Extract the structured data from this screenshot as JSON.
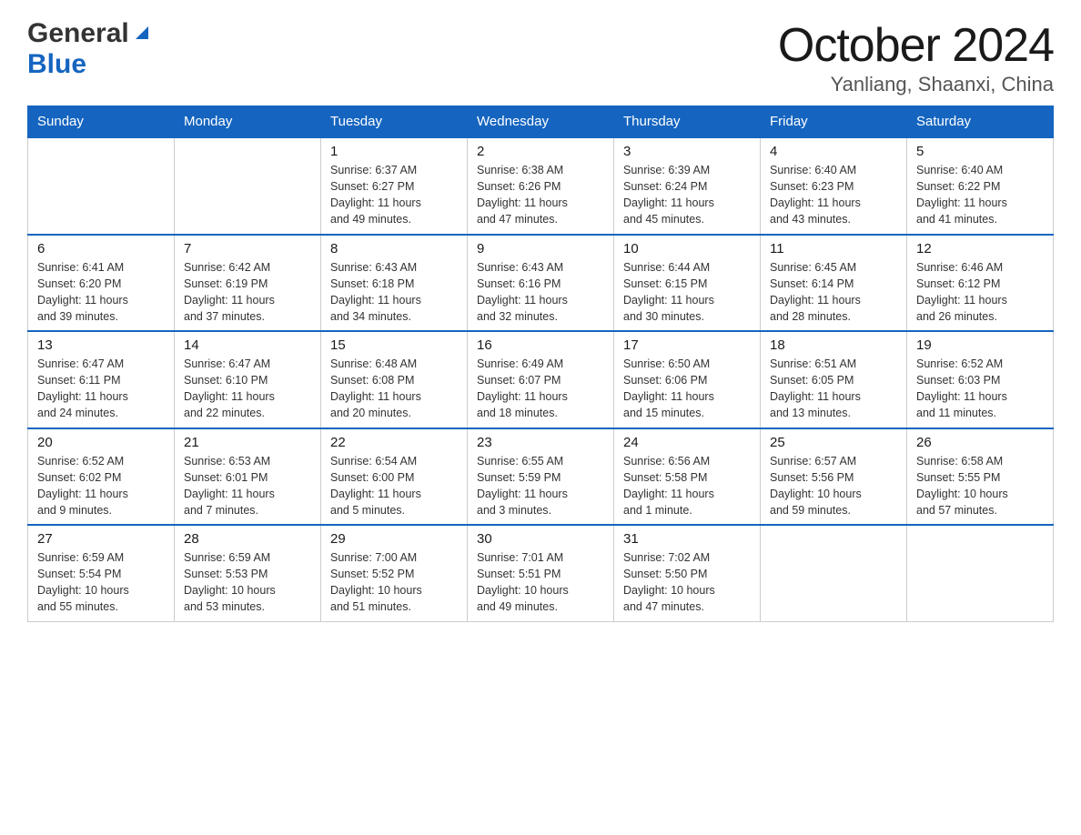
{
  "header": {
    "month_title": "October 2024",
    "location": "Yanliang, Shaanxi, China",
    "logo_general": "General",
    "logo_blue": "Blue"
  },
  "calendar": {
    "days_of_week": [
      "Sunday",
      "Monday",
      "Tuesday",
      "Wednesday",
      "Thursday",
      "Friday",
      "Saturday"
    ],
    "weeks": [
      [
        {
          "day": "",
          "info": ""
        },
        {
          "day": "",
          "info": ""
        },
        {
          "day": "1",
          "info": "Sunrise: 6:37 AM\nSunset: 6:27 PM\nDaylight: 11 hours\nand 49 minutes."
        },
        {
          "day": "2",
          "info": "Sunrise: 6:38 AM\nSunset: 6:26 PM\nDaylight: 11 hours\nand 47 minutes."
        },
        {
          "day": "3",
          "info": "Sunrise: 6:39 AM\nSunset: 6:24 PM\nDaylight: 11 hours\nand 45 minutes."
        },
        {
          "day": "4",
          "info": "Sunrise: 6:40 AM\nSunset: 6:23 PM\nDaylight: 11 hours\nand 43 minutes."
        },
        {
          "day": "5",
          "info": "Sunrise: 6:40 AM\nSunset: 6:22 PM\nDaylight: 11 hours\nand 41 minutes."
        }
      ],
      [
        {
          "day": "6",
          "info": "Sunrise: 6:41 AM\nSunset: 6:20 PM\nDaylight: 11 hours\nand 39 minutes."
        },
        {
          "day": "7",
          "info": "Sunrise: 6:42 AM\nSunset: 6:19 PM\nDaylight: 11 hours\nand 37 minutes."
        },
        {
          "day": "8",
          "info": "Sunrise: 6:43 AM\nSunset: 6:18 PM\nDaylight: 11 hours\nand 34 minutes."
        },
        {
          "day": "9",
          "info": "Sunrise: 6:43 AM\nSunset: 6:16 PM\nDaylight: 11 hours\nand 32 minutes."
        },
        {
          "day": "10",
          "info": "Sunrise: 6:44 AM\nSunset: 6:15 PM\nDaylight: 11 hours\nand 30 minutes."
        },
        {
          "day": "11",
          "info": "Sunrise: 6:45 AM\nSunset: 6:14 PM\nDaylight: 11 hours\nand 28 minutes."
        },
        {
          "day": "12",
          "info": "Sunrise: 6:46 AM\nSunset: 6:12 PM\nDaylight: 11 hours\nand 26 minutes."
        }
      ],
      [
        {
          "day": "13",
          "info": "Sunrise: 6:47 AM\nSunset: 6:11 PM\nDaylight: 11 hours\nand 24 minutes."
        },
        {
          "day": "14",
          "info": "Sunrise: 6:47 AM\nSunset: 6:10 PM\nDaylight: 11 hours\nand 22 minutes."
        },
        {
          "day": "15",
          "info": "Sunrise: 6:48 AM\nSunset: 6:08 PM\nDaylight: 11 hours\nand 20 minutes."
        },
        {
          "day": "16",
          "info": "Sunrise: 6:49 AM\nSunset: 6:07 PM\nDaylight: 11 hours\nand 18 minutes."
        },
        {
          "day": "17",
          "info": "Sunrise: 6:50 AM\nSunset: 6:06 PM\nDaylight: 11 hours\nand 15 minutes."
        },
        {
          "day": "18",
          "info": "Sunrise: 6:51 AM\nSunset: 6:05 PM\nDaylight: 11 hours\nand 13 minutes."
        },
        {
          "day": "19",
          "info": "Sunrise: 6:52 AM\nSunset: 6:03 PM\nDaylight: 11 hours\nand 11 minutes."
        }
      ],
      [
        {
          "day": "20",
          "info": "Sunrise: 6:52 AM\nSunset: 6:02 PM\nDaylight: 11 hours\nand 9 minutes."
        },
        {
          "day": "21",
          "info": "Sunrise: 6:53 AM\nSunset: 6:01 PM\nDaylight: 11 hours\nand 7 minutes."
        },
        {
          "day": "22",
          "info": "Sunrise: 6:54 AM\nSunset: 6:00 PM\nDaylight: 11 hours\nand 5 minutes."
        },
        {
          "day": "23",
          "info": "Sunrise: 6:55 AM\nSunset: 5:59 PM\nDaylight: 11 hours\nand 3 minutes."
        },
        {
          "day": "24",
          "info": "Sunrise: 6:56 AM\nSunset: 5:58 PM\nDaylight: 11 hours\nand 1 minute."
        },
        {
          "day": "25",
          "info": "Sunrise: 6:57 AM\nSunset: 5:56 PM\nDaylight: 10 hours\nand 59 minutes."
        },
        {
          "day": "26",
          "info": "Sunrise: 6:58 AM\nSunset: 5:55 PM\nDaylight: 10 hours\nand 57 minutes."
        }
      ],
      [
        {
          "day": "27",
          "info": "Sunrise: 6:59 AM\nSunset: 5:54 PM\nDaylight: 10 hours\nand 55 minutes."
        },
        {
          "day": "28",
          "info": "Sunrise: 6:59 AM\nSunset: 5:53 PM\nDaylight: 10 hours\nand 53 minutes."
        },
        {
          "day": "29",
          "info": "Sunrise: 7:00 AM\nSunset: 5:52 PM\nDaylight: 10 hours\nand 51 minutes."
        },
        {
          "day": "30",
          "info": "Sunrise: 7:01 AM\nSunset: 5:51 PM\nDaylight: 10 hours\nand 49 minutes."
        },
        {
          "day": "31",
          "info": "Sunrise: 7:02 AM\nSunset: 5:50 PM\nDaylight: 10 hours\nand 47 minutes."
        },
        {
          "day": "",
          "info": ""
        },
        {
          "day": "",
          "info": ""
        }
      ]
    ]
  }
}
